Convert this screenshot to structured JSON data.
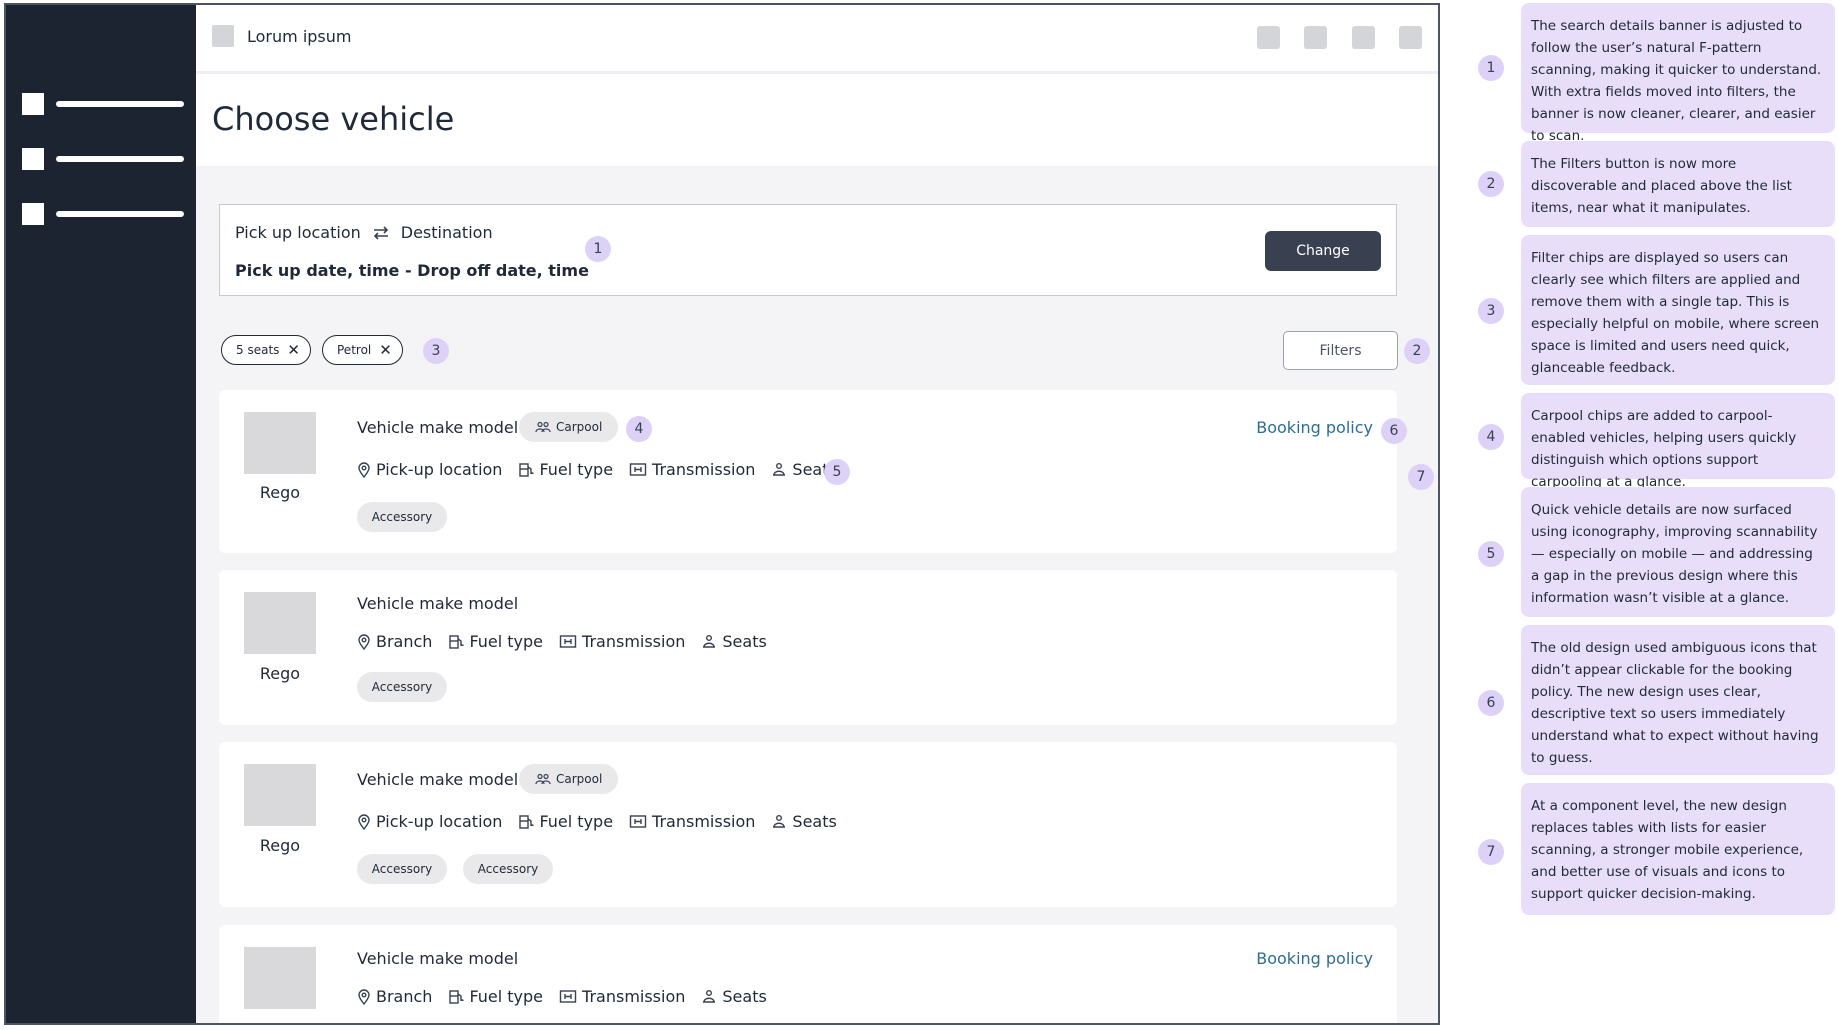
{
  "app": {
    "title": "Lorum ipsum"
  },
  "page": {
    "title": "Choose vehicle"
  },
  "banner": {
    "pickup_label": "Pick up location",
    "destination_label": "Destination",
    "dates_label": "Pick up date, time - Drop off date, time",
    "change_label": "Change"
  },
  "chips": [
    {
      "label": "5 seats"
    },
    {
      "label": "Petrol"
    }
  ],
  "filters_label": "Filters",
  "cards": [
    {
      "name": "Vehicle make model",
      "rego": "Rego",
      "carpool": "Carpool",
      "location": "Pick-up location",
      "fuel": "Fuel type",
      "transmission": "Transmission",
      "seats": "Seats",
      "accessories": [
        "Accessory"
      ],
      "policy": "Booking policy"
    },
    {
      "name": "Vehicle make model",
      "rego": "Rego",
      "location": "Branch",
      "fuel": "Fuel type",
      "transmission": "Transmission",
      "seats": "Seats",
      "accessories": [
        "Accessory"
      ]
    },
    {
      "name": "Vehicle make model",
      "rego": "Rego",
      "carpool": "Carpool",
      "location": "Pick-up location",
      "fuel": "Fuel type",
      "transmission": "Transmission",
      "seats": "Seats",
      "accessories": [
        "Accessory",
        "Accessory"
      ]
    },
    {
      "name": "Vehicle make model",
      "rego": "Rego",
      "location": "Branch",
      "fuel": "Fuel type",
      "transmission": "Transmission",
      "seats": "Seats",
      "policy": "Booking policy"
    }
  ],
  "badges": {
    "banner": "1",
    "filters": "2",
    "chips": "3",
    "carpool": "4",
    "details": "5",
    "policy": "6",
    "list": "7"
  },
  "annotations": [
    {
      "number": "1",
      "text": "The search details banner is adjusted to follow the user’s natural F-pattern scanning, making it quicker to understand. With extra fields moved into filters, the banner is now cleaner, clearer, and easier to scan."
    },
    {
      "number": "2",
      "text": "The Filters button is now more discoverable and placed above the list items, near what it manipulates."
    },
    {
      "number": "3",
      "text": "Filter chips are displayed so users can clearly see which filters are applied and remove them with a single tap. This is especially helpful on mobile, where screen space is limited and users need quick, glanceable feedback."
    },
    {
      "number": "4",
      "text": "Carpool chips are added to carpool-enabled vehicles, helping users quickly distinguish which options support carpooling at a glance."
    },
    {
      "number": "5",
      "text": "Quick vehicle details are now surfaced using iconography, improving scannability — especially on mobile — and addressing a gap in the previous design where this information wasn’t visible at a glance."
    },
    {
      "number": "6",
      "text": "The old design used ambiguous icons that didn’t appear clickable for the booking policy. The new design uses clear, descriptive text so users immediately understand what to expect without having to guess."
    },
    {
      "number": "7",
      "text": "At a component level, the new design replaces tables with lists for easier scanning, a stronger mobile experience, and better use of visuals and icons to support quicker decision-making."
    }
  ],
  "colors": {
    "sidebar": "#1c2331",
    "change_button": "#394150",
    "badge": "#ddd1f7",
    "annotation_bg": "#e9def9",
    "policy_link": "#2c6e93"
  }
}
